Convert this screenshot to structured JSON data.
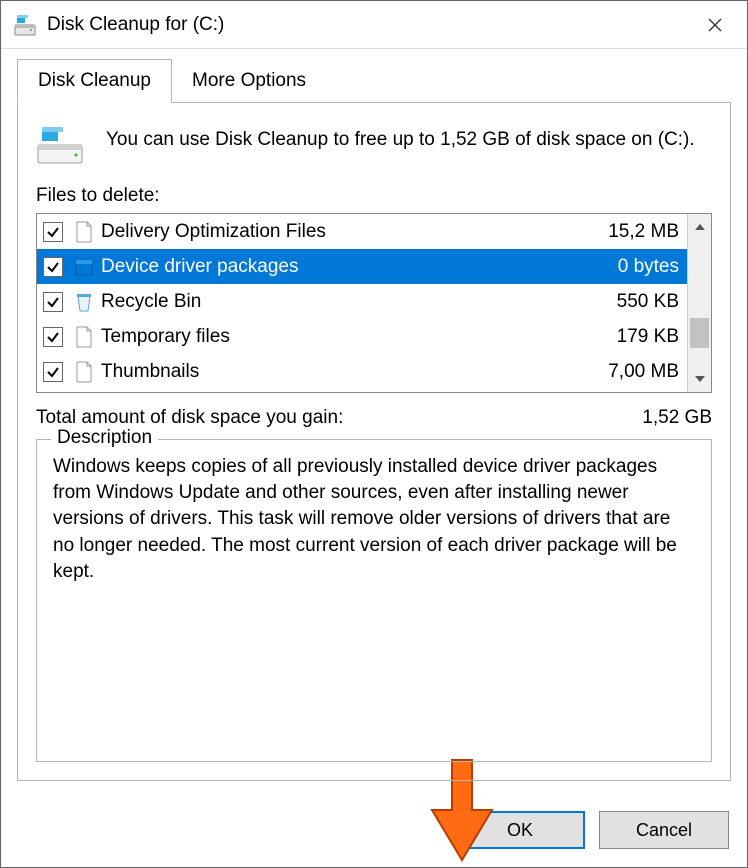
{
  "window": {
    "title": "Disk Cleanup for  (C:)"
  },
  "tabs": {
    "active": "Disk Cleanup",
    "inactive": "More Options"
  },
  "intro": "You can use Disk Cleanup to free up to 1,52 GB of disk space on  (C:).",
  "files_label": "Files to delete:",
  "files": [
    {
      "name": "Delivery Optimization Files",
      "size": "15,2 MB",
      "checked": true,
      "icon": "page"
    },
    {
      "name": "Device driver packages",
      "size": "0 bytes",
      "checked": true,
      "icon": "box",
      "selected": true
    },
    {
      "name": "Recycle Bin",
      "size": "550 KB",
      "checked": true,
      "icon": "bin"
    },
    {
      "name": "Temporary files",
      "size": "179 KB",
      "checked": true,
      "icon": "page"
    },
    {
      "name": "Thumbnails",
      "size": "7,00 MB",
      "checked": true,
      "icon": "page"
    }
  ],
  "total": {
    "label": "Total amount of disk space you gain:",
    "value": "1,52 GB"
  },
  "description": {
    "legend": "Description",
    "text": "Windows keeps copies of all previously installed device driver packages from Windows Update and other sources, even after installing newer versions of drivers. This task will remove older versions of drivers that are no longer needed. The most current version of each driver package will be kept."
  },
  "buttons": {
    "ok": "OK",
    "cancel": "Cancel"
  }
}
